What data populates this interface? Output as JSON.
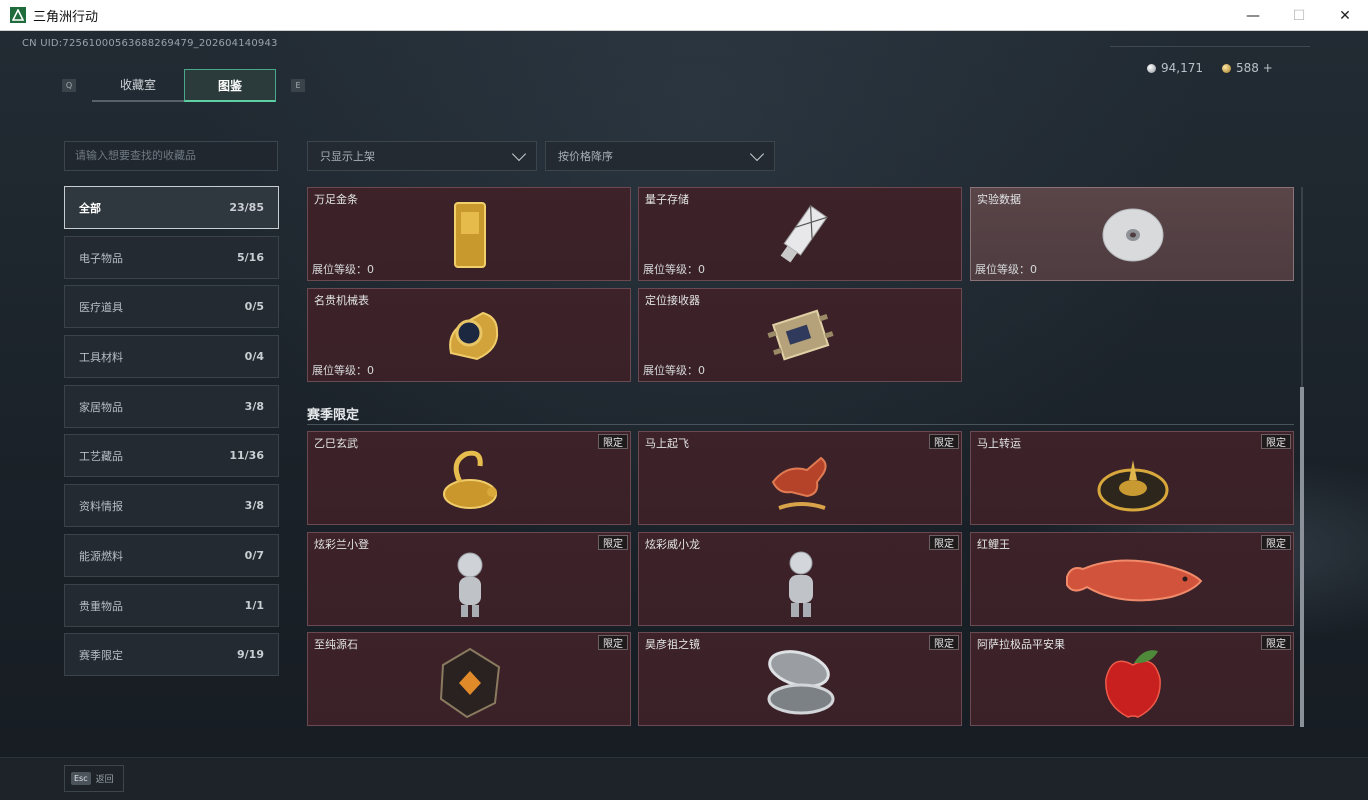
{
  "window": {
    "title": "三角洲行动",
    "minimize": "—",
    "maximize": "☐",
    "close": "✕"
  },
  "uid": "CN UID:7256100056368826947​9_202604140943",
  "tabs": {
    "prev_key": "Q",
    "next_key": "E",
    "items": [
      {
        "label": "收藏室"
      },
      {
        "label": "图鉴"
      }
    ]
  },
  "currency": {
    "silver": "94,171",
    "gold": "588 +"
  },
  "search": {
    "placeholder": "请输入想要查找的收藏品"
  },
  "categories": [
    {
      "label": "全部",
      "count": "23/85"
    },
    {
      "label": "电子物品",
      "count": "5/16"
    },
    {
      "label": "医疗道具",
      "count": "0/5"
    },
    {
      "label": "工具材料",
      "count": "0/4"
    },
    {
      "label": "家居物品",
      "count": "3/8"
    },
    {
      "label": "工艺藏品",
      "count": "11/36"
    },
    {
      "label": "资料情报",
      "count": "3/8"
    },
    {
      "label": "能源燃料",
      "count": "0/7"
    },
    {
      "label": "贵重物品",
      "count": "1/1"
    },
    {
      "label": "赛季限定",
      "count": "9/19"
    }
  ],
  "filters": {
    "shelf": "只显示上架",
    "sort": "按价格降序"
  },
  "items": [
    {
      "name": "万足金条",
      "level": "展位等级：0",
      "icon": "gold-bar"
    },
    {
      "name": "量子存储",
      "level": "展位等级：0",
      "icon": "usb-drive"
    },
    {
      "name": "实验数据",
      "level": "展位等级：0",
      "icon": "disc"
    },
    {
      "name": "名贵机械表",
      "level": "展位等级：0",
      "icon": "watch"
    },
    {
      "name": "定位接收器",
      "level": "展位等级：0",
      "icon": "receiver"
    }
  ],
  "season": {
    "title": "赛季限定",
    "badge": "限定",
    "items": [
      {
        "name": "乙巳玄武",
        "icon": "golden-snake-turtle"
      },
      {
        "name": "马上起飞",
        "icon": "red-horse"
      },
      {
        "name": "马上转运",
        "icon": "golden-compass"
      },
      {
        "name": "炫彩兰小登",
        "icon": "silver-figurine"
      },
      {
        "name": "炫彩威小龙",
        "icon": "silver-figurine-2"
      },
      {
        "name": "红鲤王",
        "icon": "red-carp"
      },
      {
        "name": "至纯源石",
        "icon": "source-stone"
      },
      {
        "name": "昊彦祖之镜",
        "icon": "compact-mirror"
      },
      {
        "name": "阿萨拉极品平安果",
        "icon": "red-apple"
      }
    ]
  },
  "footer": {
    "esc": "Esc",
    "back": "返回"
  },
  "colors": {
    "accent": "#5fd0a5",
    "card_red": "#3d2329",
    "card_light": "#5a4548"
  }
}
